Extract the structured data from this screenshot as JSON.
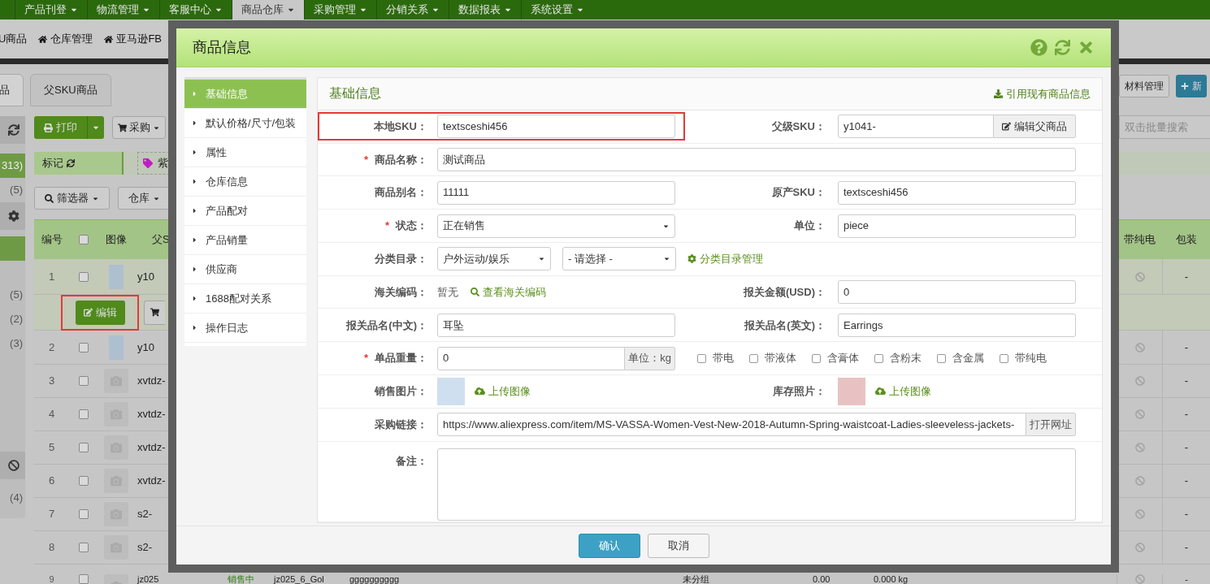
{
  "top_nav": [
    {
      "label": "产品刊登",
      "selected": false
    },
    {
      "label": "物流管理",
      "selected": false
    },
    {
      "label": "客服中心",
      "selected": false
    },
    {
      "label": "商品仓库",
      "selected": true
    },
    {
      "label": "采购管理",
      "selected": false
    },
    {
      "label": "分销关系",
      "selected": false
    },
    {
      "label": "数据报表",
      "selected": false
    },
    {
      "label": "系统设置",
      "selected": false
    }
  ],
  "sub_nav": [
    {
      "label": "U商品",
      "icon": false
    },
    {
      "label": "仓库管理",
      "icon": true
    },
    {
      "label": "亚马逊FB",
      "icon": true
    }
  ],
  "page_tabs": [
    {
      "label": "品",
      "selected": true
    },
    {
      "label": "父SKU商品",
      "selected": false
    }
  ],
  "side_panel": [
    {
      "items": [
        {
          "text": "313)",
          "selected": true
        },
        {
          "text": "(5)",
          "selected": false
        }
      ]
    },
    {
      "items": [
        {
          "selected": true
        },
        {
          "text": "(5)",
          "selected": false
        },
        {
          "text": "(2)",
          "selected": false
        },
        {
          "text": "(3)",
          "selected": false
        }
      ]
    },
    {
      "items": [
        {
          "text": "(4)",
          "selected": false
        }
      ]
    }
  ],
  "toolbar": {
    "print": "打印",
    "purchase": "采购"
  },
  "mark_bar": {
    "label": "标记",
    "tag": "紫"
  },
  "filters": [
    "筛选器",
    "仓库"
  ],
  "right_buttons": [
    {
      "label": "材料管理",
      "kind": "default"
    },
    {
      "label": "新",
      "kind": "primary"
    }
  ],
  "search": {
    "placeholder": "双击批量搜索"
  },
  "table": {
    "header": {
      "number": "编号",
      "select_all_checked": false,
      "image": "图像",
      "parent": "父S",
      "battery": "带纯电",
      "package": "包装"
    },
    "rows": [
      {
        "no": "1",
        "checked": false,
        "has_photo": true,
        "parent": "y10",
        "package": "-",
        "selected": true,
        "actions": {
          "edit": "编辑",
          "highlighted": true
        }
      },
      {
        "no": "2",
        "checked": false,
        "has_photo": true,
        "parent": "y10",
        "package": "-",
        "selected": false
      },
      {
        "no": "3",
        "checked": false,
        "has_photo": false,
        "parent": "xvtdz-",
        "package": "-",
        "selected": false
      },
      {
        "no": "4",
        "checked": false,
        "has_photo": false,
        "parent": "xvtdz-",
        "package": "-",
        "selected": false
      },
      {
        "no": "5",
        "checked": false,
        "has_photo": false,
        "parent": "xvtdz-",
        "package": "-",
        "selected": false
      },
      {
        "no": "6",
        "checked": false,
        "has_photo": false,
        "parent": "xvtdz-",
        "package": "-",
        "selected": false
      },
      {
        "no": "7",
        "checked": false,
        "has_photo": false,
        "parent": "s2-",
        "package": "-",
        "selected": false
      },
      {
        "no": "8",
        "checked": false,
        "has_photo": false,
        "parent": "s2-",
        "package": "-",
        "selected": false
      },
      {
        "no": "9",
        "checked": false,
        "has_photo": false,
        "parent": "jz025",
        "status": "销售中",
        "sku": "jz025_6_Gol",
        "name": "gggggggggg",
        "group": "未分组",
        "price": "0.00",
        "weight": "0.000 kg",
        "package": "-",
        "selected": false
      }
    ]
  },
  "modal": {
    "title": "商品信息",
    "nav": [
      {
        "label": "基础信息",
        "selected": true
      },
      {
        "label": "默认价格/尺寸/包装",
        "selected": false
      },
      {
        "label": "属性",
        "selected": false
      },
      {
        "label": "仓库信息",
        "selected": false
      },
      {
        "label": "产品配对",
        "selected": false
      },
      {
        "label": "产品销量",
        "selected": false
      },
      {
        "label": "供应商",
        "selected": false
      },
      {
        "label": "1688配对关系",
        "selected": false
      },
      {
        "label": "操作日志",
        "selected": false
      }
    ],
    "section_title": "基础信息",
    "section_link": "引用现有商品信息",
    "rows": [
      {
        "left": {
          "label": "本地SKU：",
          "kind": "input",
          "value": "textsceshi456",
          "highlighted": true
        },
        "right": {
          "label": "父级SKU：",
          "kind": "input_button",
          "value": "y1041-",
          "button": "编辑父商品"
        }
      },
      {
        "left": {
          "label": "商品名称：",
          "required_mark": "*",
          "kind": "input",
          "value": "测试商品",
          "wide": true
        }
      },
      {
        "left": {
          "label": "商品别名：",
          "kind": "input",
          "value": "11111"
        },
        "right": {
          "label": "原产SKU：",
          "kind": "input",
          "value": "textsceshi456"
        }
      },
      {
        "left": {
          "label": "状态：",
          "required_mark": "*",
          "kind": "select",
          "value": "正在销售"
        },
        "right": {
          "label": "单位：",
          "kind": "input",
          "value": "piece"
        }
      },
      {
        "left": {
          "label": "分类目录：",
          "kind": "select_pair",
          "values": [
            "户外运动/娱乐",
            "- 请选择 -"
          ],
          "link": "分类目录管理"
        }
      },
      {
        "left": {
          "label": "海关编码：",
          "kind": "text_link",
          "text": "暂无",
          "link": "查看海关编码"
        },
        "right": {
          "label": "报关金额(USD)：",
          "kind": "input",
          "value": "0"
        }
      },
      {
        "left": {
          "label": "报关品名(中文)：",
          "kind": "input",
          "value": "耳坠"
        },
        "right": {
          "label": "报关品名(英文)：",
          "kind": "input",
          "value": "Earrings"
        }
      },
      {
        "left": {
          "label": "单品重量：",
          "required_mark": "*",
          "kind": "input_unit",
          "value": "0",
          "unit": "单位：kg"
        },
        "options": [
          {
            "label": "带电",
            "checked": false
          },
          {
            "label": "带液体",
            "checked": false
          },
          {
            "label": "含膏体",
            "checked": false
          },
          {
            "label": "含粉末",
            "checked": false
          },
          {
            "label": "含金属",
            "checked": false
          },
          {
            "label": "带纯电",
            "checked": false
          }
        ]
      },
      {
        "left": {
          "label": "销售图片：",
          "kind": "image_upload",
          "link": "上传图像"
        },
        "right": {
          "label": "库存照片：",
          "kind": "image_upload",
          "link": "上传图像"
        }
      },
      {
        "left": {
          "label": "采购链接：",
          "kind": "url",
          "value": "https://www.aliexpress.com/item/MS-VASSA-Women-Vest-New-2018-Autumn-Spring-waistcoat-Ladies-sleeveless-jackets-",
          "button": "打开网址",
          "wide": true
        }
      },
      {
        "left": {
          "label": "备注：",
          "kind": "textarea",
          "wide": true
        }
      }
    ],
    "buttons": [
      {
        "label": "确认",
        "kind": "primary"
      },
      {
        "label": "取消",
        "kind": "default"
      }
    ]
  }
}
